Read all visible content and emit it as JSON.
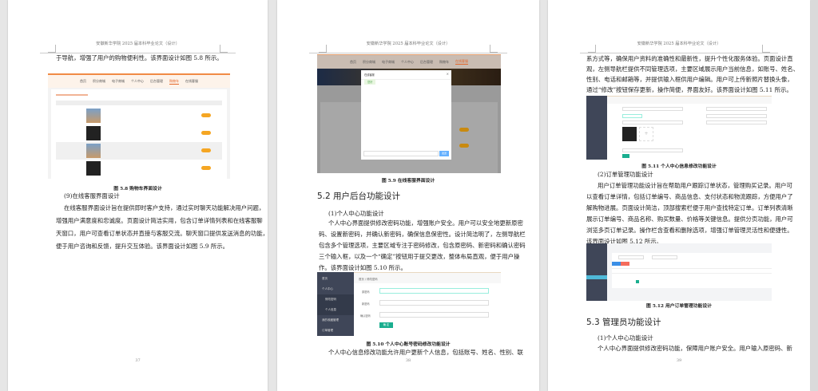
{
  "header": "安徽新华学院 2025 届本科毕业论文（设计）",
  "pages": [
    {
      "number": "37",
      "lines_top": [
        "于导航，增强了用户的购物便利性。该界面设计如图 5.8 所示。"
      ],
      "figure_caption": "图 5.8  购物车界面设计",
      "subheading": "(9)在线客服界面设计",
      "paragraph": [
        "在线客服界面设计旨在提供即时客户支持，通过实时聊天功能解决用户问题，",
        "增强用户满意度和忠诚度。页面设计简洁实用，包含订单详情列表和在线客服聊",
        "天窗口，用户可查看订单状态并直接与客服交流。聊天窗口提供发送消息的功能，",
        "便于用户咨询和反馈，提升交互体验。该界面设计如图 5.9 所示。"
      ]
    },
    {
      "number": "38",
      "figure_caption": "图 5.9  在线客服界面设计",
      "section": "5.2  用户后台功能设计",
      "subheading": "(1)个人中心功能设计",
      "paragraph": [
        "个人中心界面提供修改密码功能，增强账户安全。用户可以安全地更新原密",
        "码、设置新密码，并确认新密码，确保信息保密性。设计简洁明了，左侧导航栏",
        "包含多个管理选项，主要区域专注于密码修改，包含原密码、新密码和确认密码",
        "三个输入框，以及一个“确定”按钮用于提交更改，整体布局直观，便于用户操",
        "作。该界面设计如图 5.10 所示。"
      ],
      "figure2_caption": "图 5.10  个人中心账号密码修改功能设计",
      "lines_bottom": [
        "个人中心信息修改功能允许用户更新个人信息，包括账号、姓名、性别、联"
      ]
    },
    {
      "number": "39",
      "lines_top": [
        "系方式等，确保用户资料的准确性和最新性，提升个性化服务体验。页面设计直",
        "观，左侧导航栏提供不同管理选项，主要区域展示用户当前信息，如账号、姓名、",
        "性别、电话和邮箱等，并提供输入框供用户编辑。用户可上传新照片替换头像，",
        "通过“修改”按钮保存更新，操作简便，界面友好。该界面设计如图 5.11 所示。"
      ],
      "figure_caption": "图 5.11  个人中心信息修改功能设计",
      "subheading": "(2)订单管理功能设计",
      "paragraph": [
        "用户订单管理功能设计旨在帮助用户跟踪订单状态，管理购买记录。用户可",
        "以查看订单详情，包括订单编号、商品信息、支付状态和物流跟踪，方便用户了",
        "解购物进展。页面设计简洁，顶部搜索栏便于用户查找特定订单。订单列表清晰",
        "展示订单编号、商品名称、购买数量、价格等关键信息。提供分页功能，用户可",
        "浏览多页订单记录。操作栏含查看和删除选项，增强订单管理灵活性和便捷性。",
        "该界面设计如图 5.12 所示。"
      ],
      "figure2_caption": "图 5.12  用户订单管理功能设计",
      "section": "5.3  管理员功能设计",
      "subheading2": "(1)个人中心功能设计",
      "lines_bottom": [
        "个人中心界面提供修改密码功能，保障用户账户安全。用户输入原密码、新"
      ]
    }
  ],
  "shop_nav": [
    "首页",
    "积分商城",
    "电子商城",
    "个人中心",
    "后台管理",
    "购物车",
    "在线客服"
  ],
  "shop_nav_active_fig58": 5,
  "shop_nav_active_fig59": 6,
  "chat": {
    "title": "在线客服",
    "message": "您好",
    "send": "发送"
  },
  "admin": {
    "menu": [
      "首页",
      "个人中心",
      "修改密码",
      "个人信息",
      "我的收藏管理",
      "订单管理"
    ],
    "breadcrumb": "首页 / 修改密码",
    "fields": [
      "原密码",
      "新密码",
      "确认密码"
    ],
    "confirm": "确 定"
  },
  "colors": {
    "accent": "#e4672b",
    "sidebar": "#3f4658",
    "green": "#1aae8f",
    "orange": "#f5a623"
  }
}
